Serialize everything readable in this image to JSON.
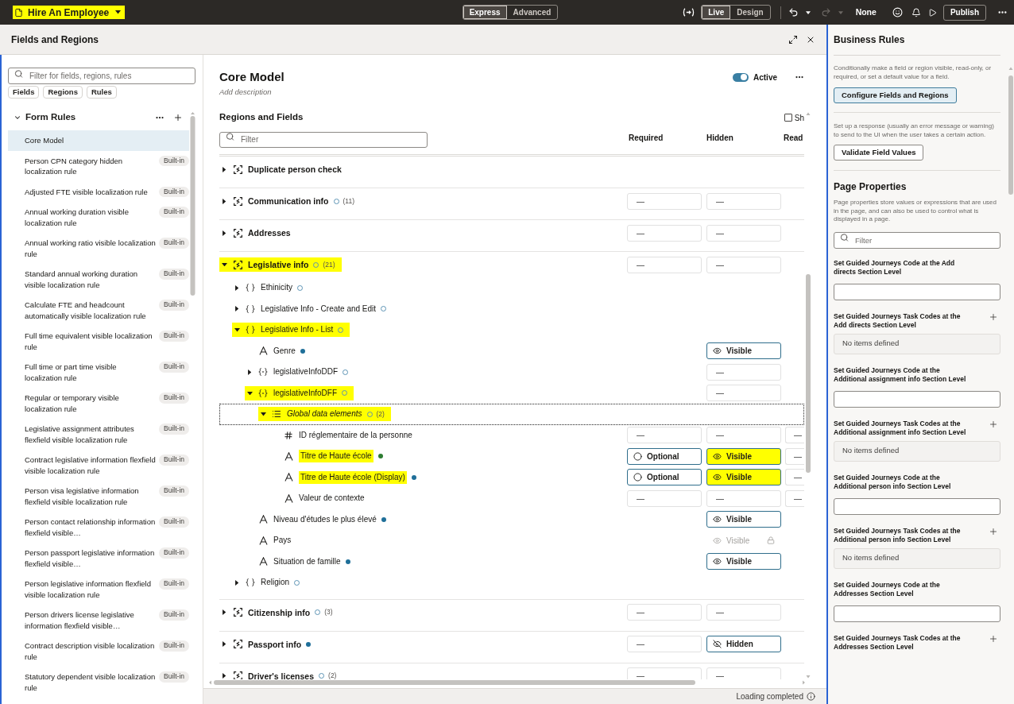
{
  "app_bar": {
    "title": {
      "label": "Hire An Employee",
      "highlighted": true
    },
    "modes": [
      {
        "label": "Express",
        "selected": true
      },
      {
        "label": "Advanced",
        "selected": false
      }
    ],
    "views": [
      {
        "label": "Live",
        "selected": true
      },
      {
        "label": "Design",
        "selected": false
      }
    ],
    "history": [
      {
        "kind": "undo",
        "disabled": false
      },
      {
        "kind": "redo",
        "disabled": true
      }
    ],
    "persona": "None",
    "publish": "Publish"
  },
  "dialog": {
    "title": "Fields and Regions"
  },
  "sidebar": {
    "search": {
      "placeholder": "Filter for fields, regions, rules"
    },
    "filters": [
      "Fields",
      "Regions",
      "Rules"
    ],
    "section": {
      "title": "Form Rules",
      "expanded": true
    },
    "rules": [
      {
        "name": "Core Model",
        "selected": true
      },
      {
        "name": "Person CPN category hidden localization rule",
        "badge": "Built-in",
        "selected": false
      },
      {
        "name": "Adjusted FTE visible localization rule",
        "badge": "Built-in",
        "selected": false
      },
      {
        "name": "Annual working duration visible localization rule",
        "badge": "Built-in",
        "selected": false
      },
      {
        "name": "Annual working ratio visible localization rule",
        "badge": "Built-in",
        "selected": false
      },
      {
        "name": "Standard annual working duration visible localization rule",
        "badge": "Built-in",
        "selected": false
      },
      {
        "name": "Calculate FTE and headcount automatically visible localization rule",
        "badge": "Built-in",
        "selected": false
      },
      {
        "name": "Full time equivalent visible localization rule",
        "badge": "Built-in",
        "selected": false
      },
      {
        "name": "Full time or part time visible localization rule",
        "badge": "Built-in",
        "selected": false
      },
      {
        "name": "Regular or temporary visible localization rule",
        "badge": "Built-in",
        "selected": false
      },
      {
        "name": "Legislative assignment attributes flexfield visible localization rule",
        "badge": "Built-in",
        "selected": false
      },
      {
        "name": "Contract legislative information flexfield visible localization rule",
        "badge": "Built-in",
        "selected": false
      },
      {
        "name": "Person visa legislative information flexfield visible localization rule",
        "badge": "Built-in",
        "selected": false
      },
      {
        "name": "Person contact relationship information flexfield visible…",
        "badge": "Built-in",
        "selected": false
      },
      {
        "name": "Person passport legislative information flexfield visible…",
        "badge": "Built-in",
        "selected": false
      },
      {
        "name": "Person legislative information flexfield visible localization rule",
        "badge": "Built-in",
        "selected": false
      },
      {
        "name": "Person drivers license legislative information flexfield visible…",
        "badge": "Built-in",
        "selected": false
      },
      {
        "name": "Contract description visible localization rule",
        "badge": "Built-in",
        "selected": false
      },
      {
        "name": "Statutory dependent visible localization rule",
        "badge": "Built-in",
        "selected": false
      }
    ]
  },
  "editor": {
    "title": "Core Model",
    "description_hint": "Add description",
    "status": {
      "label": "Active",
      "on": true
    },
    "section_title": "Regions and Fields",
    "show_option": {
      "label": "Sh",
      "checked": false
    },
    "filter": {
      "placeholder": "Filter"
    },
    "columns": [
      "Required",
      "Hidden",
      "Read"
    ],
    "rows": [
      {
        "label": "Duplicate person check",
        "kind": "region",
        "expanded": false,
        "highlighted": false,
        "focused": false
      },
      {
        "label": "Communication info",
        "kind": "region",
        "dot": {
          "kind": "ring"
        },
        "count": "(11)",
        "expanded": false,
        "highlighted": false,
        "focused": false,
        "cells": {
          "required": {
            "kind": "value",
            "text": "—"
          },
          "hidden": {
            "kind": "value",
            "text": "—"
          }
        }
      },
      {
        "label": "Addresses",
        "kind": "region",
        "expanded": false,
        "highlighted": false,
        "focused": false,
        "cells": {
          "required": {
            "kind": "value",
            "text": "—"
          },
          "hidden": {
            "kind": "value",
            "text": "—"
          }
        }
      },
      {
        "label": "Legislative info",
        "kind": "region",
        "dot": {
          "kind": "ring"
        },
        "count": "(21)",
        "expanded": true,
        "highlighted": true,
        "focused": false,
        "cells": {
          "required": {
            "kind": "value",
            "text": "—"
          },
          "hidden": {
            "kind": "value",
            "text": "—"
          }
        },
        "children": [
          {
            "label": "Ethinicity",
            "kind": "group",
            "dot": {
              "kind": "ring"
            },
            "expanded": false,
            "highlighted": false,
            "focused": false
          },
          {
            "label": "Legislative Info - Create and Edit",
            "kind": "group",
            "dot": {
              "kind": "ring"
            },
            "expanded": false,
            "highlighted": false,
            "focused": false
          },
          {
            "label": "Legislative Info - List",
            "kind": "group",
            "dot": {
              "kind": "ring"
            },
            "expanded": true,
            "highlighted": true,
            "focused": false,
            "children": [
              {
                "label": "Genre",
                "kind": "text_field",
                "dot": {
                  "kind": "filled",
                  "color": "#1f6f99"
                },
                "highlighted": false,
                "focused": false,
                "cells": {
                  "hidden": {
                    "kind": "visible",
                    "text": "Visible"
                  }
                }
              },
              {
                "label": "legislativeInfoDDF",
                "kind": "flexfield",
                "dot": {
                  "kind": "ring"
                },
                "expanded": false,
                "highlighted": false,
                "focused": false,
                "cells": {
                  "hidden": {
                    "kind": "value",
                    "text": "—"
                  }
                }
              },
              {
                "label": "legislativeInfoDFF",
                "kind": "flexfield",
                "dot": {
                  "kind": "ring"
                },
                "expanded": true,
                "highlighted": true,
                "focused": false,
                "cells": {
                  "hidden": {
                    "kind": "value",
                    "text": "—"
                  }
                },
                "children": [
                  {
                    "label": "Global data elements",
                    "kind": "list",
                    "dot": {
                      "kind": "ring"
                    },
                    "count": "(2)",
                    "expanded": true,
                    "highlighted": true,
                    "focused": true,
                    "children": [
                      {
                        "label": "ID réglementaire de la personne",
                        "kind": "number_field",
                        "highlighted": false,
                        "focused": false,
                        "cells": {
                          "required": {
                            "kind": "value",
                            "text": "—"
                          },
                          "hidden": {
                            "kind": "value",
                            "text": "—"
                          },
                          "read_only": {
                            "kind": "value",
                            "text": "—"
                          }
                        }
                      },
                      {
                        "label": "Titre de Haute école",
                        "kind": "text_field",
                        "dot": {
                          "kind": "filled",
                          "color": "#2e7d32"
                        },
                        "highlighted": true,
                        "focused": false,
                        "cells": {
                          "required": {
                            "kind": "optional",
                            "text": "Optional"
                          },
                          "hidden": {
                            "kind": "visible",
                            "text": "Visible",
                            "highlighted": true
                          },
                          "read_only": {
                            "kind": "value",
                            "text": "—"
                          }
                        }
                      },
                      {
                        "label": "Titre de Haute école (Display)",
                        "kind": "text_field",
                        "dot": {
                          "kind": "filled",
                          "color": "#1f6f99"
                        },
                        "highlighted": true,
                        "focused": false,
                        "cells": {
                          "required": {
                            "kind": "optional",
                            "text": "Optional"
                          },
                          "hidden": {
                            "kind": "visible",
                            "text": "Visible",
                            "highlighted": true
                          },
                          "read_only": {
                            "kind": "value",
                            "text": "—"
                          }
                        }
                      },
                      {
                        "label": "Valeur de contexte",
                        "kind": "text_field",
                        "highlighted": false,
                        "focused": false,
                        "cells": {
                          "required": {
                            "kind": "value",
                            "text": "—"
                          },
                          "hidden": {
                            "kind": "value",
                            "text": "—"
                          },
                          "read_only": {
                            "kind": "value",
                            "text": "—"
                          }
                        }
                      }
                    ]
                  }
                ]
              },
              {
                "label": "Niveau d'études le plus élevé",
                "kind": "text_field",
                "dot": {
                  "kind": "filled",
                  "color": "#1f6f99"
                },
                "highlighted": false,
                "focused": false,
                "cells": {
                  "hidden": {
                    "kind": "visible",
                    "text": "Visible"
                  }
                }
              },
              {
                "label": "Pays",
                "kind": "text_field",
                "highlighted": false,
                "focused": false,
                "cells": {
                  "hidden": {
                    "kind": "locked",
                    "text": "Visible"
                  }
                }
              },
              {
                "label": "Situation de famille",
                "kind": "text_field",
                "dot": {
                  "kind": "filled",
                  "color": "#1f6f99"
                },
                "highlighted": false,
                "focused": false,
                "cells": {
                  "hidden": {
                    "kind": "visible",
                    "text": "Visible"
                  }
                }
              }
            ]
          },
          {
            "label": "Religion",
            "kind": "group",
            "dot": {
              "kind": "ring"
            },
            "expanded": false,
            "highlighted": false,
            "focused": false
          }
        ]
      },
      {
        "label": "Citizenship info",
        "kind": "region",
        "dot": {
          "kind": "ring"
        },
        "count": "(3)",
        "expanded": false,
        "highlighted": false,
        "focused": false,
        "cells": {
          "required": {
            "kind": "value",
            "text": "—"
          },
          "hidden": {
            "kind": "value",
            "text": "—"
          }
        }
      },
      {
        "label": "Passport info",
        "kind": "region",
        "dot": {
          "kind": "filled",
          "color": "#1f6f99"
        },
        "expanded": false,
        "highlighted": false,
        "focused": false,
        "cells": {
          "required": {
            "kind": "value",
            "text": "—"
          },
          "hidden": {
            "kind": "hidden",
            "text": "Hidden"
          }
        }
      },
      {
        "label": "Driver's licenses",
        "kind": "region",
        "dot": {
          "kind": "ring"
        },
        "count": "(2)",
        "expanded": false,
        "highlighted": false,
        "focused": false,
        "cells": {
          "required": {
            "kind": "value",
            "text": "—"
          },
          "hidden": {
            "kind": "value",
            "text": "—"
          }
        }
      }
    ]
  },
  "status_bar": {
    "text": "Loading completed"
  },
  "business_rules": {
    "title": "Business Rules",
    "description": "Conditionally make a field or region visible, read-only, or required, or set a default value for a field.",
    "configure_button": "Configure Fields and Regions",
    "response_description": "Set up a response (usually an error message or warning) to send to the UI when the user takes a certain action.",
    "validate_button": "Validate Field Values",
    "page_properties": {
      "title": "Page Properties",
      "description": "Page properties store values or expressions that are used in the page, and can also be used to control what is displayed in a page.",
      "filter": {
        "placeholder": "Filter"
      },
      "properties": [
        {
          "label": "Set Guided Journeys Code at the Add directs Section Level",
          "kind": "text"
        },
        {
          "label": "Set Guided Journeys Task Codes at the Add directs Section Level",
          "kind": "list",
          "empty_text": "No items defined"
        },
        {
          "label": "Set Guided Journeys Code at the Additional assignment info Section Level",
          "kind": "text"
        },
        {
          "label": "Set Guided Journeys Task Codes at the Additional assignment info Section Level",
          "kind": "list",
          "empty_text": "No items defined"
        },
        {
          "label": "Set Guided Journeys Code at the Additional person info Section Level",
          "kind": "text"
        },
        {
          "label": "Set Guided Journeys Task Codes at the Additional person info Section Level",
          "kind": "list",
          "empty_text": "No items defined"
        },
        {
          "label": "Set Guided Journeys Code at the Addresses Section Level",
          "kind": "text"
        },
        {
          "label": "Set Guided Journeys Task Codes at the Addresses Section Level",
          "kind": "list"
        }
      ]
    }
  }
}
